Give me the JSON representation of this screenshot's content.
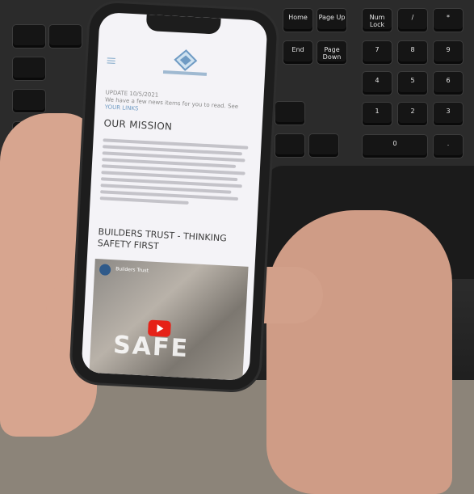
{
  "phone_screen": {
    "update_text": "UPDATE 10/5/2021",
    "update_sub": "We have a few news items for you to read. See",
    "update_link": "YOUR LINKS",
    "heading_mission": "OUR MISSION",
    "mission_paragraph_lines": 10,
    "heading_builders": "BUILDERS TRUST - THINKING SAFETY FIRST",
    "video_title": "Builders Trust",
    "video_overlay_word": "SAFE"
  },
  "keyboard_keys": [
    {
      "label": "Home"
    },
    {
      "label": "Page Up"
    },
    {
      "label": "Num Lock"
    },
    {
      "label": "/"
    },
    {
      "label": "*"
    },
    {
      "label": "End"
    },
    {
      "label": "Page Down"
    },
    {
      "label": "7"
    },
    {
      "label": "8"
    },
    {
      "label": "9"
    },
    {
      "label": "4"
    },
    {
      "label": "5"
    },
    {
      "label": "6"
    },
    {
      "label": "1"
    },
    {
      "label": "2"
    },
    {
      "label": "3"
    },
    {
      "label": "0"
    },
    {
      "label": "."
    }
  ]
}
